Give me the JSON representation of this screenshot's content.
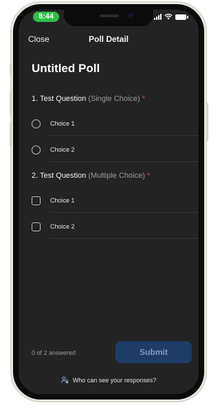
{
  "status": {
    "time": "8:44"
  },
  "nav": {
    "close_label": "Close",
    "title": "Poll Detail"
  },
  "poll": {
    "title": "Untitled Poll",
    "questions": [
      {
        "number_text": "1. Test Question",
        "type_text": "(Single Choice)",
        "required_mark": "*",
        "choices": [
          "Choice 1",
          "Choice 2"
        ]
      },
      {
        "number_text": "2. Test Question",
        "type_text": "(Multiple Choice)",
        "required_mark": "*",
        "choices": [
          "Choice 1",
          "Choice 2"
        ]
      }
    ]
  },
  "footer": {
    "answered_text": "0 of 2 answered",
    "submit_label": "Submit",
    "privacy_text": "Who can see your responses?",
    "privacy_icon": "person-lock-icon"
  },
  "colors": {
    "background": "#232323",
    "time_pill": "#2fbe4a",
    "required": "#e0454b",
    "submit_bg": "#1e3d66",
    "submit_text": "#7f9bbf"
  }
}
